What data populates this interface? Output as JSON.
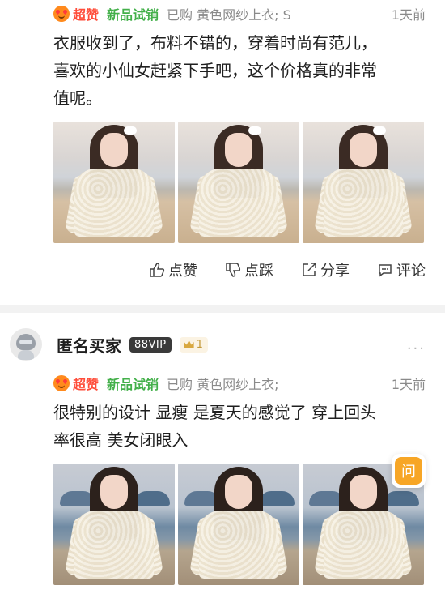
{
  "review1": {
    "badge_super": "超赞",
    "badge_new": "新品试销",
    "purchase": "已购 黄色网纱上衣; S",
    "time": "1天前",
    "text_line1": "衣服收到了，布料不错的，穿着时尚有范儿，",
    "text_line2": "喜欢的小仙女赶紧下手吧，这个价格真的非常",
    "text_line3": "值呢。"
  },
  "actions": {
    "like": "点赞",
    "dislike": "点踩",
    "share": "分享",
    "comment": "评论"
  },
  "review2": {
    "username": "匿名买家",
    "vip": "88VIP",
    "crown_count": "1",
    "more": "...",
    "badge_super": "超赞",
    "badge_new": "新品试销",
    "purchase": "已购 黄色网纱上衣;",
    "time": "1天前",
    "text_line1": "很特别的设计 显瘦 是夏天的感觉了 穿上回头",
    "text_line2": "率很高 美女闭眼入"
  },
  "ask_button": {
    "label": "问"
  },
  "colors": {
    "super": "#ff4d3a",
    "new": "#43b04a",
    "meta": "#8a8a8a",
    "ask": "#f7a626"
  }
}
